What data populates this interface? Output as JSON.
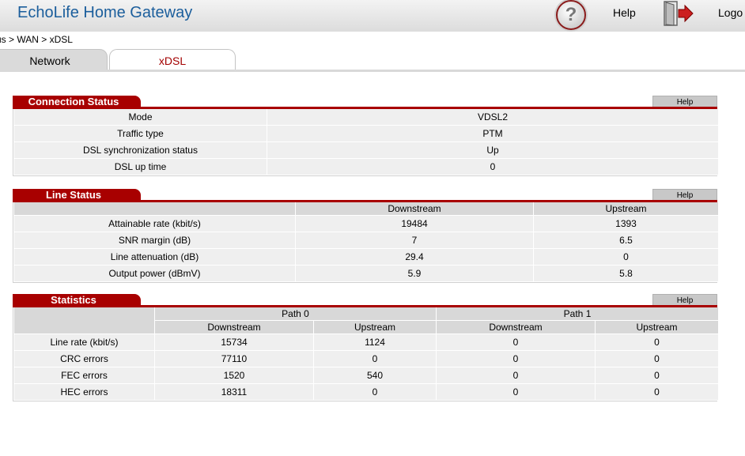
{
  "header": {
    "brand": "EchoLife Home Gateway",
    "help_label": "Help",
    "logout_label": "Logo"
  },
  "breadcrumb": "us > WAN > xDSL",
  "tabs": [
    {
      "label": "Network"
    },
    {
      "label": "xDSL"
    }
  ],
  "connection_status": {
    "title": "Connection Status",
    "help": "Help",
    "rows": [
      {
        "label": "Mode",
        "value": "VDSL2"
      },
      {
        "label": "Traffic type",
        "value": "PTM"
      },
      {
        "label": "DSL synchronization status",
        "value": "Up"
      },
      {
        "label": "DSL up time",
        "value": "0"
      }
    ]
  },
  "line_status": {
    "title": "Line Status",
    "help": "Help",
    "columns": [
      "",
      "Downstream",
      "Upstream"
    ],
    "rows": [
      {
        "label": "Attainable rate (kbit/s)",
        "down": "19484",
        "up": "1393"
      },
      {
        "label": "SNR margin (dB)",
        "down": "7",
        "up": "6.5"
      },
      {
        "label": "Line attenuation (dB)",
        "down": "29.4",
        "up": "0"
      },
      {
        "label": "Output power (dBmV)",
        "down": "5.9",
        "up": "5.8"
      }
    ]
  },
  "statistics": {
    "title": "Statistics",
    "help": "Help",
    "paths": [
      "Path 0",
      "Path 1"
    ],
    "subcolumns": [
      "Downstream",
      "Upstream",
      "Downstream",
      "Upstream"
    ],
    "rows": [
      {
        "label": "Line rate (kbit/s)",
        "p0d": "15734",
        "p0u": "1124",
        "p1d": "0",
        "p1u": "0"
      },
      {
        "label": "CRC errors",
        "p0d": "77110",
        "p0u": "0",
        "p1d": "0",
        "p1u": "0"
      },
      {
        "label": "FEC errors",
        "p0d": "1520",
        "p0u": "540",
        "p1d": "0",
        "p1u": "0"
      },
      {
        "label": "HEC errors",
        "p0d": "18311",
        "p0u": "0",
        "p1d": "0",
        "p1u": "0"
      }
    ]
  },
  "colors": {
    "accent": "#a80000",
    "brand": "#1b5e9c"
  }
}
